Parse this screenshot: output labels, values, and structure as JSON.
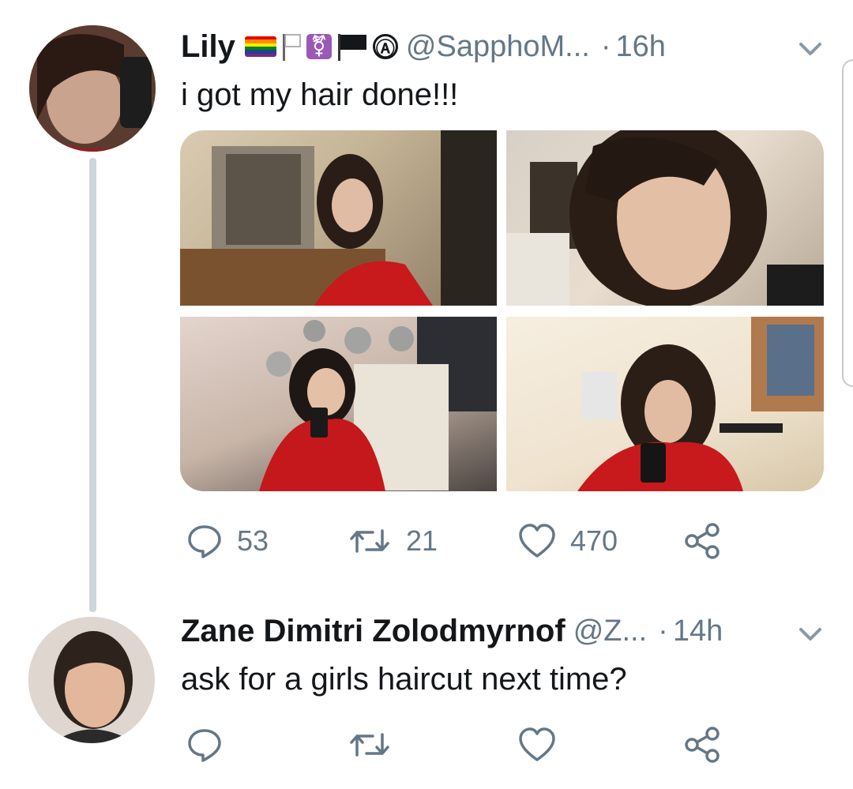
{
  "tweet1": {
    "author_name": "Lily",
    "handle": "@SapphoM...",
    "separator": "·",
    "time": "16h",
    "text": "i got my hair done!!!",
    "flags": [
      "rainbow-flag",
      "white-flag",
      "transgender-symbol",
      "black-flag",
      "circled-a"
    ],
    "circled_a": "Ⓐ",
    "trans_symbol": "⚧",
    "reply_count": "53",
    "retweet_count": "21",
    "like_count": "470"
  },
  "tweet2": {
    "author_name": "Zane Dimitri Zolodmyrnof",
    "handle": "@Z...",
    "separator": "·",
    "time": "14h",
    "text": "ask for a girls haircut next time?"
  },
  "colors": {
    "text_primary": "#14171a",
    "text_secondary": "#657786",
    "thread_line": "#ccd6dd",
    "pride": [
      "#e40303",
      "#ff8c00",
      "#ffed00",
      "#008026",
      "#24408e",
      "#732982"
    ]
  }
}
